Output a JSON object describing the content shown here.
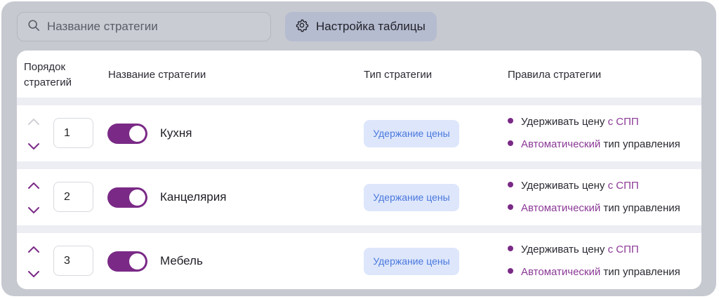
{
  "toolbar": {
    "search_placeholder": "Название стратегии",
    "settings_label": "Настройка таблицы"
  },
  "table": {
    "headers": {
      "order_line1": "Порядок",
      "order_line2": "стратегий",
      "name": "Название стратегии",
      "type": "Тип стратегии",
      "rules": "Правила стратегии"
    },
    "rows": [
      {
        "order": "1",
        "name": "Кухня",
        "enabled": true,
        "type": "Удержание цены",
        "rule1_text": "Удерживать цену",
        "rule1_accent": "с СПП",
        "rule2_accent": "Автоматический",
        "rule2_text": "тип управления",
        "up_arrow_enabled": false
      },
      {
        "order": "2",
        "name": "Канцелярия",
        "enabled": true,
        "type": "Удержание цены",
        "rule1_text": "Удерживать цену",
        "rule1_accent": "с СПП",
        "rule2_accent": "Автоматический",
        "rule2_text": "тип управления",
        "up_arrow_enabled": true
      },
      {
        "order": "3",
        "name": "Мебель",
        "enabled": true,
        "type": "Удержание цены",
        "rule1_text": "Удерживать цену",
        "rule1_accent": "с СПП",
        "rule2_accent": "Автоматический",
        "rule2_text": "тип управления",
        "up_arrow_enabled": true
      }
    ]
  },
  "colors": {
    "accent": "#7a2a86",
    "chip_bg": "#dde6fb",
    "chip_text": "#4a78dd",
    "arrow_disabled": "#cfd1d6"
  },
  "icons": {
    "search": "search-icon",
    "settings": "gear-icon",
    "up": "chevron-up-icon",
    "down": "chevron-down-icon"
  }
}
